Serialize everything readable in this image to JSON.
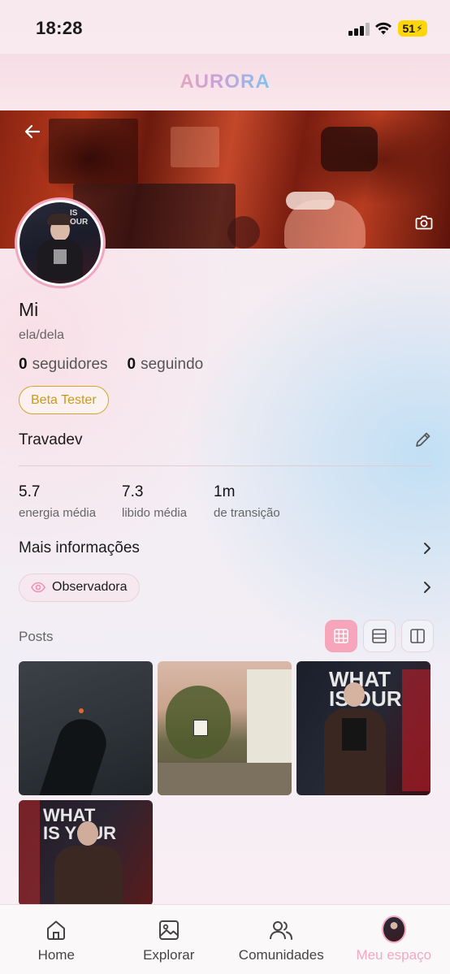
{
  "status": {
    "time": "18:28",
    "battery": "51"
  },
  "app": {
    "logo": "AURORA"
  },
  "profile": {
    "name": "Mi",
    "pronouns": "ela/dela",
    "followers_count": "0",
    "followers_label": "seguidores",
    "following_count": "0",
    "following_label": "seguindo",
    "badge": "Beta Tester",
    "bio": "Travadev"
  },
  "stats": [
    {
      "value": "5.7",
      "label": "energia média"
    },
    {
      "value": "7.3",
      "label": "libido média"
    },
    {
      "value": "1m",
      "label": "de transição"
    }
  ],
  "more_info": {
    "label": "Mais informações"
  },
  "observer": {
    "label": "Observadora"
  },
  "posts": {
    "label": "Posts"
  },
  "nav": [
    {
      "label": "Home",
      "icon": "home-icon"
    },
    {
      "label": "Explorar",
      "icon": "image-icon"
    },
    {
      "label": "Comunidades",
      "icon": "users-icon"
    },
    {
      "label": "Meu espaço",
      "icon": "avatar"
    }
  ],
  "colors": {
    "accent_pink": "#f6a5bb",
    "badge_gold": "#d4a529"
  }
}
